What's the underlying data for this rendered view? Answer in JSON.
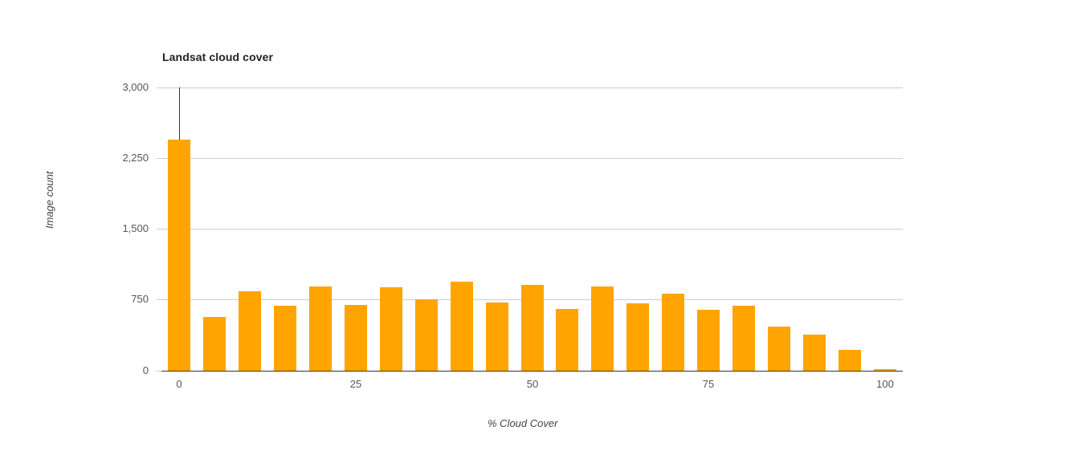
{
  "chart_data": {
    "type": "bar",
    "title": "Landsat cloud cover",
    "xlabel": "% Cloud Cover",
    "ylabel": "Image count",
    "categories": [
      0,
      5,
      10,
      15,
      20,
      25,
      30,
      35,
      40,
      45,
      50,
      55,
      60,
      65,
      70,
      75,
      80,
      85,
      90,
      95,
      100
    ],
    "values": [
      2450,
      570,
      845,
      690,
      895,
      700,
      880,
      760,
      945,
      725,
      910,
      655,
      895,
      710,
      820,
      650,
      690,
      470,
      385,
      220,
      15
    ],
    "series": [
      {
        "name": "Image count",
        "values": [
          2450,
          570,
          845,
          690,
          895,
          700,
          880,
          760,
          945,
          725,
          910,
          655,
          895,
          710,
          820,
          650,
          690,
          470,
          385,
          220,
          15
        ]
      }
    ],
    "xlim": [
      -2.5,
      102.5
    ],
    "ylim": [
      0,
      3000
    ],
    "xticks": [
      "0",
      "25",
      "50",
      "75",
      "100"
    ],
    "xtick_values": [
      0,
      25,
      50,
      75,
      100
    ],
    "yticks": [
      "0",
      "750",
      "1,500",
      "2,250",
      "3,000"
    ],
    "ytick_values": [
      0,
      750,
      1500,
      2250,
      3000
    ],
    "grid": "horizontal",
    "legend": "none",
    "bar_color": "#ffa400",
    "gridline_color": "#cccccc",
    "axis_color": "#333333",
    "tick_label_color": "#555555",
    "title_color": "#222222",
    "annotation": {
      "type": "vertical-pointer-line",
      "at_category": 0,
      "from_value": 3000,
      "to_value": 2450,
      "color": "#333333"
    }
  }
}
